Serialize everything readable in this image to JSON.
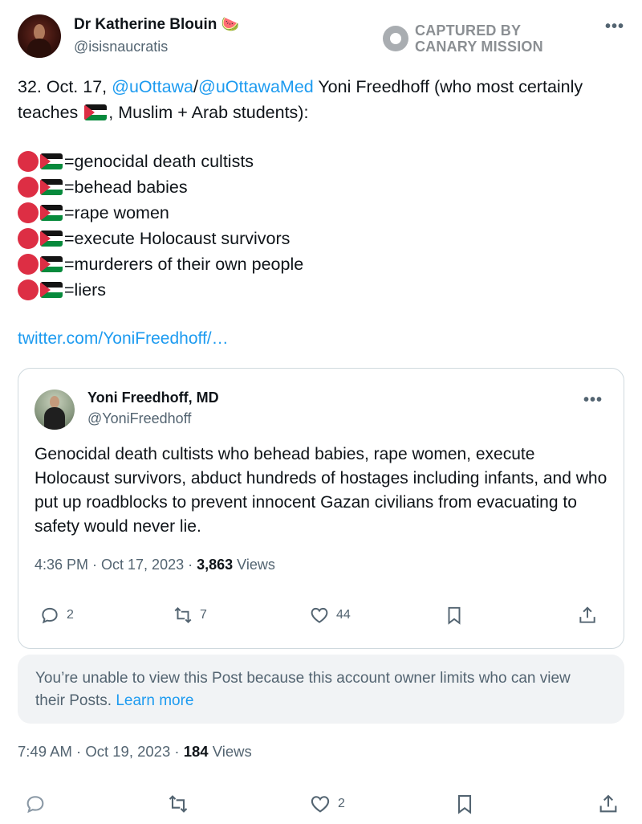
{
  "author": {
    "name": "Dr Katherine Blouin",
    "name_emoji": "🍉",
    "handle": "@isisnaucratis"
  },
  "watermark": {
    "line1": "CAPTURED BY",
    "line2": "CANARY MISSION"
  },
  "tweet": {
    "text_prefix": "32. Oct. 17, ",
    "mention1": "@uOttawa",
    "slash": "/",
    "mention2": "@uOttawaMed",
    "text_mid": " Yoni Freedhoff (who most certainly teaches ",
    "text_suffix": ", Muslim + Arab students):",
    "list": [
      "=genocidal death cultists",
      "=behead babies",
      "=rape women",
      "=execute Holocaust survivors",
      "=murderers of their own people",
      "=liers"
    ],
    "link": "twitter.com/YoniFreedhoff/…"
  },
  "quoted": {
    "name": "Yoni Freedhoff, MD",
    "handle": "@YoniFreedhoff",
    "text": "Genocidal death cultists who behead babies, rape women, execute Holocaust survivors, abduct hundreds of hostages including infants, and who put up roadblocks to prevent innocent Gazan civilians from evacuating to safety would never lie.",
    "timestamp": "4:36 PM · Oct 17, 2023 · ",
    "views_count": "3,863",
    "views_label": " Views",
    "replies": "2",
    "retweets": "7",
    "likes": "44"
  },
  "notice": {
    "text": "You’re unable to view this Post because this account owner limits who can view their Posts. ",
    "learn_more": "Learn more"
  },
  "meta": {
    "timestamp": "7:49 AM · Oct 19, 2023 · ",
    "views_count": "184",
    "views_label": " Views"
  },
  "actions": {
    "likes": "2"
  },
  "colors": {
    "link": "#1d9bf0",
    "secondary_text": "#536471",
    "red_dot": "#dd2e44"
  }
}
